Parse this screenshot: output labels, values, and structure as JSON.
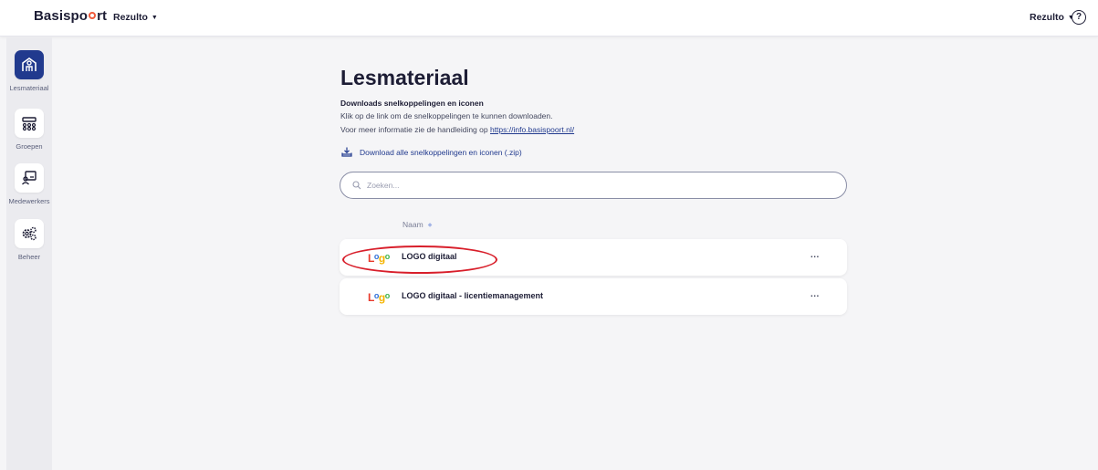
{
  "header": {
    "brand_part1": "Basispo",
    "brand_part2": "rt",
    "org_menu": "Rezulto",
    "user_menu": "Rezulto",
    "help_label": "?"
  },
  "sidebar": {
    "items": [
      {
        "label": "Lesmateriaal",
        "icon": "book-building-icon",
        "active": true
      },
      {
        "label": "Groepen",
        "icon": "group-icon",
        "active": false
      },
      {
        "label": "Medewerkers",
        "icon": "teacher-board-icon",
        "active": false
      },
      {
        "label": "Beheer",
        "icon": "gears-icon",
        "active": false
      }
    ]
  },
  "main": {
    "title": "Lesmateriaal",
    "subtitle": "Downloads snelkoppelingen en iconen",
    "desc_line1": "Klik op de link om de snelkoppelingen te kunnen downloaden.",
    "desc_line2_prefix": "Voor meer informatie zie de handleiding op ",
    "desc_line2_link": "https://info.basispoort.nl/",
    "download_all": "Download alle snelkoppelingen en iconen (.zip)",
    "search_placeholder": "Zoeken...",
    "column_name": "Naam",
    "rows": [
      {
        "logo": "logo",
        "name": "LOGO digitaal",
        "more": "..."
      },
      {
        "logo": "logo",
        "name": "LOGO digitaal - licentiemanagement",
        "more": "..."
      }
    ]
  },
  "colors": {
    "accent": "#213a8e",
    "annotation": "#d81e2a",
    "brand_dot": "#f05a3c"
  }
}
